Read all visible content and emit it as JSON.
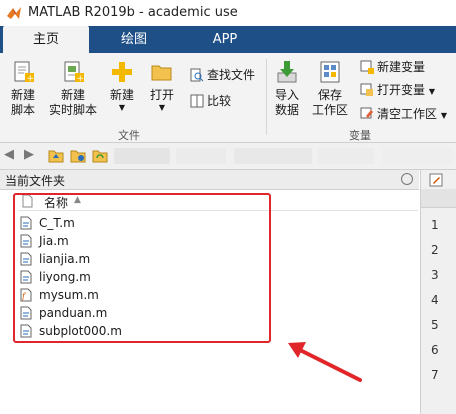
{
  "window": {
    "title": "MATLAB R2019b - academic use"
  },
  "tabs": [
    {
      "label": "主页",
      "active": true
    },
    {
      "label": "绘图",
      "active": false
    },
    {
      "label": "APP",
      "active": false
    }
  ],
  "ribbon": {
    "new_script": "新建\n脚本",
    "new_live_script": "新建\n实时脚本",
    "new": "新建",
    "open": "打开",
    "find_files": "查找文件",
    "compare": "比较",
    "file_section": "文件",
    "import_data": "导入\n数据",
    "save_workspace": "保存\n工作区",
    "new_variable": "新建变量",
    "open_variable": "打开变量",
    "clear_workspace": "清空工作区",
    "variable_section": "变量"
  },
  "current_folder": {
    "title": "当前文件夹",
    "column_name": "名称",
    "files": [
      {
        "name": "C_T.m"
      },
      {
        "name": "Jia.m"
      },
      {
        "name": "lianjia.m"
      },
      {
        "name": "liyong.m"
      },
      {
        "name": "mysum.m"
      },
      {
        "name": "panduan.m"
      },
      {
        "name": "subplot000.m"
      }
    ]
  },
  "editor": {
    "line_numbers": [
      "1",
      "2",
      "3",
      "4",
      "5",
      "6",
      "7"
    ]
  },
  "colors": {
    "tabbar": "#1e4f87",
    "highlight_box": "#e0262a",
    "arrow": "#e0262a"
  }
}
